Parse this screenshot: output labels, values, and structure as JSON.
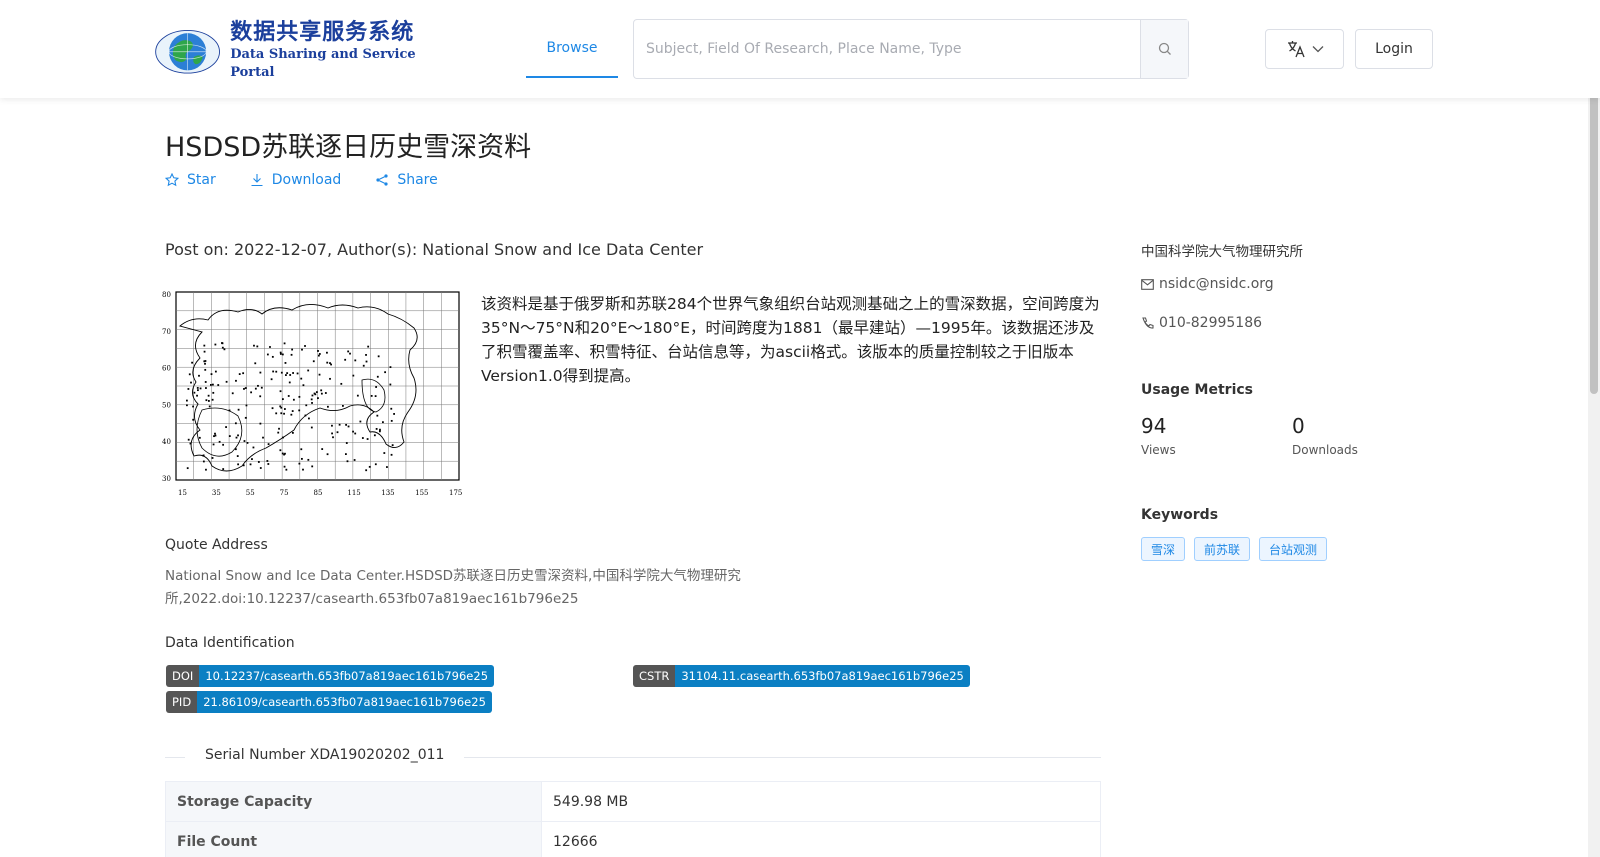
{
  "header": {
    "logo_cn": "数据共享服务系统",
    "logo_en": "Data Sharing and Service Portal",
    "nav_browse": "Browse",
    "search_placeholder": "Subject, Field Of Research, Place Name, Type",
    "login_label": "Login",
    "accent_color": "#1e88e5"
  },
  "dataset": {
    "title": "HSDSD苏联逐日历史雪深资料",
    "actions": {
      "star": "Star",
      "download": "Download",
      "share": "Share"
    },
    "post_on": "Post on: 2022-12-07, Author(s): National Snow and Ice Data Center",
    "description": "该资料是基于俄罗斯和苏联284个世界气象组织台站观测基础之上的雪深数据，空间跨度为35°N～75°N和20°E～180°E，时间跨度为1881（最早建站）—1995年。该数据还涉及了积雪覆盖率、积雪特征、台站信息等，为ascii格式。该版本的质量控制较之于旧版本Version1.0得到提高。",
    "map": {
      "y_ticks": [
        "80",
        "70",
        "60",
        "50",
        "40",
        "30"
      ],
      "x_ticks": [
        "15",
        "35",
        "55",
        "75",
        "85",
        "115",
        "135",
        "155",
        "175"
      ]
    },
    "quote_label": "Quote Address",
    "quote_text": "National Snow and Ice Data Center.HSDSD苏联逐日历史雪深资料,中国科学院大气物理研究所,2022.doi:10.12237/casearth.653fb07a819aec161b796e25",
    "ident_label": "Data Identification",
    "identifiers": {
      "doi_key": "DOI",
      "doi_value": "10.12237/casearth.653fb07a819aec161b796e25",
      "cstr_key": "CSTR",
      "cstr_value": "31104.11.casearth.653fb07a819aec161b796e25",
      "pid_key": "PID",
      "pid_value": "21.86109/casearth.653fb07a819aec161b796e25"
    },
    "serial_number": "Serial Number XDA19020202_011",
    "table": [
      {
        "label": "Storage Capacity",
        "value": "549.98 MB"
      },
      {
        "label": "File Count",
        "value": "12666"
      }
    ]
  },
  "sidebar": {
    "organization": "中国科学院大气物理研究所",
    "email": "nsidc@nsidc.org",
    "phone": "010-82995186",
    "metrics_label": "Usage Metrics",
    "views_value": "94",
    "views_label": "Views",
    "downloads_value": "0",
    "downloads_label": "Downloads",
    "keywords_label": "Keywords",
    "keywords": [
      "雪深",
      "前苏联",
      "台站观测"
    ]
  }
}
